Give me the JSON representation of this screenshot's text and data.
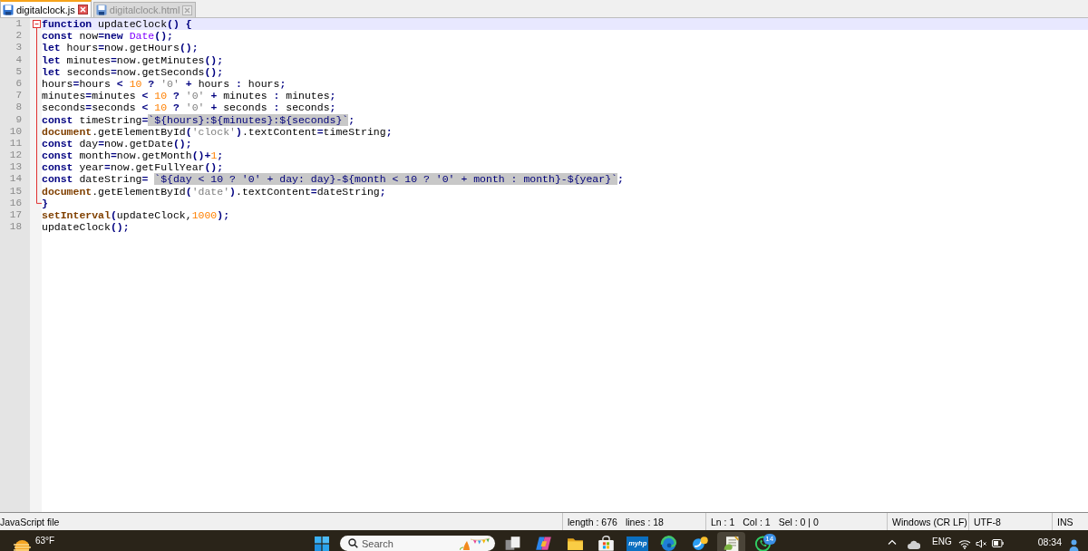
{
  "tabs": [
    {
      "label": "digitalclock.js",
      "selected": true
    },
    {
      "label": "digitalclock.html",
      "selected": false
    }
  ],
  "editor": {
    "lines": [
      {
        "number": "1",
        "current": true,
        "expanded": true,
        "tokens": [
          {
            "kind": "keyword",
            "text": "function"
          },
          {
            "kind": "plain",
            "text": " updateClock"
          },
          {
            "kind": "operator",
            "text": "() {"
          }
        ],
        "children": [
          {
            "number": "2",
            "current": false,
            "tokens": [
              {
                "kind": "keyword",
                "text": "const"
              },
              {
                "kind": "plain",
                "text": " now"
              },
              {
                "kind": "operator",
                "text": "="
              },
              {
                "kind": "keyword",
                "text": "new"
              },
              {
                "kind": "class",
                "text": " Date"
              },
              {
                "kind": "operator",
                "text": "();"
              }
            ]
          },
          {
            "number": "3",
            "current": false,
            "tokens": [
              {
                "kind": "keyword",
                "text": "let"
              },
              {
                "kind": "plain",
                "text": " hours"
              },
              {
                "kind": "operator",
                "text": "="
              },
              {
                "kind": "plain",
                "text": "now.getHours"
              },
              {
                "kind": "operator",
                "text": "();"
              }
            ]
          },
          {
            "number": "4",
            "current": false,
            "tokens": [
              {
                "kind": "keyword",
                "text": "let"
              },
              {
                "kind": "plain",
                "text": " minutes"
              },
              {
                "kind": "operator",
                "text": "="
              },
              {
                "kind": "plain",
                "text": "now.getMinutes"
              },
              {
                "kind": "operator",
                "text": "();"
              }
            ]
          },
          {
            "number": "5",
            "current": false,
            "tokens": [
              {
                "kind": "keyword",
                "text": "let"
              },
              {
                "kind": "plain",
                "text": " seconds"
              },
              {
                "kind": "operator",
                "text": "="
              },
              {
                "kind": "plain",
                "text": "now.getSeconds"
              },
              {
                "kind": "operator",
                "text": "();"
              }
            ]
          },
          {
            "number": "6",
            "current": false,
            "tokens": [
              {
                "kind": "plain",
                "text": "hours"
              },
              {
                "kind": "operator",
                "text": "="
              },
              {
                "kind": "plain",
                "text": "hours "
              },
              {
                "kind": "operator",
                "text": "< "
              },
              {
                "kind": "number",
                "text": "10"
              },
              {
                "kind": "operator",
                "text": " ? "
              },
              {
                "kind": "string",
                "text": "'0'"
              },
              {
                "kind": "operator",
                "text": " + "
              },
              {
                "kind": "plain",
                "text": "hours "
              },
              {
                "kind": "operator",
                "text": ":"
              },
              {
                "kind": "plain",
                "text": " hours"
              },
              {
                "kind": "operator",
                "text": ";"
              }
            ]
          },
          {
            "number": "7",
            "current": false,
            "tokens": [
              {
                "kind": "plain",
                "text": "minutes"
              },
              {
                "kind": "operator",
                "text": "="
              },
              {
                "kind": "plain",
                "text": "minutes "
              },
              {
                "kind": "operator",
                "text": "< "
              },
              {
                "kind": "number",
                "text": "10"
              },
              {
                "kind": "operator",
                "text": " ? "
              },
              {
                "kind": "string",
                "text": "'0'"
              },
              {
                "kind": "operator",
                "text": " + "
              },
              {
                "kind": "plain",
                "text": "minutes "
              },
              {
                "kind": "operator",
                "text": ":"
              },
              {
                "kind": "plain",
                "text": " minutes"
              },
              {
                "kind": "operator",
                "text": ";"
              }
            ]
          },
          {
            "number": "8",
            "current": false,
            "tokens": [
              {
                "kind": "plain",
                "text": "seconds"
              },
              {
                "kind": "operator",
                "text": "="
              },
              {
                "kind": "plain",
                "text": "seconds "
              },
              {
                "kind": "operator",
                "text": "< "
              },
              {
                "kind": "number",
                "text": "10"
              },
              {
                "kind": "operator",
                "text": " ? "
              },
              {
                "kind": "string",
                "text": "'0'"
              },
              {
                "kind": "operator",
                "text": " + "
              },
              {
                "kind": "plain",
                "text": "seconds "
              },
              {
                "kind": "operator",
                "text": ":"
              },
              {
                "kind": "plain",
                "text": " seconds"
              },
              {
                "kind": "operator",
                "text": ";"
              }
            ]
          },
          {
            "number": "9",
            "current": false,
            "tokens": [
              {
                "kind": "keyword",
                "text": "const"
              },
              {
                "kind": "plain",
                "text": " timeString"
              },
              {
                "kind": "operator",
                "text": "="
              },
              {
                "kind": "template",
                "text": "`${hours}:${minutes}:${seconds}`"
              },
              {
                "kind": "operator",
                "text": ";"
              }
            ]
          },
          {
            "number": "10",
            "current": false,
            "tokens": [
              {
                "kind": "object",
                "text": "document"
              },
              {
                "kind": "plain",
                "text": ".getElementById"
              },
              {
                "kind": "operator",
                "text": "("
              },
              {
                "kind": "string",
                "text": "'clock'"
              },
              {
                "kind": "operator",
                "text": ")"
              },
              {
                "kind": "plain",
                "text": ".textContent"
              },
              {
                "kind": "operator",
                "text": "="
              },
              {
                "kind": "plain",
                "text": "timeString"
              },
              {
                "kind": "operator",
                "text": ";"
              }
            ]
          },
          {
            "number": "11",
            "current": false,
            "tokens": [
              {
                "kind": "keyword",
                "text": "const"
              },
              {
                "kind": "plain",
                "text": " day"
              },
              {
                "kind": "operator",
                "text": "="
              },
              {
                "kind": "plain",
                "text": "now.getDate"
              },
              {
                "kind": "operator",
                "text": "();"
              }
            ]
          },
          {
            "number": "12",
            "current": false,
            "tokens": [
              {
                "kind": "keyword",
                "text": "const"
              },
              {
                "kind": "plain",
                "text": " month"
              },
              {
                "kind": "operator",
                "text": "="
              },
              {
                "kind": "plain",
                "text": "now.getMonth"
              },
              {
                "kind": "operator",
                "text": "()+"
              },
              {
                "kind": "number",
                "text": "1"
              },
              {
                "kind": "operator",
                "text": ";"
              }
            ]
          },
          {
            "number": "13",
            "current": false,
            "tokens": [
              {
                "kind": "keyword",
                "text": "const"
              },
              {
                "kind": "plain",
                "text": " year"
              },
              {
                "kind": "operator",
                "text": "="
              },
              {
                "kind": "plain",
                "text": "now.getFullYear"
              },
              {
                "kind": "operator",
                "text": "();"
              }
            ]
          },
          {
            "number": "14",
            "current": false,
            "tokens": [
              {
                "kind": "keyword",
                "text": "const"
              },
              {
                "kind": "plain",
                "text": " dateString"
              },
              {
                "kind": "operator",
                "text": "= "
              },
              {
                "kind": "template",
                "text": "`${day < 10 ? '0' + day: day}-${month < 10 ? '0' + month : month}-${year}`"
              },
              {
                "kind": "operator",
                "text": ";"
              }
            ]
          },
          {
            "number": "15",
            "current": false,
            "tokens": [
              {
                "kind": "object",
                "text": "document"
              },
              {
                "kind": "plain",
                "text": ".getElementById"
              },
              {
                "kind": "operator",
                "text": "("
              },
              {
                "kind": "string",
                "text": "'date'"
              },
              {
                "kind": "operator",
                "text": ")"
              },
              {
                "kind": "plain",
                "text": ".textContent"
              },
              {
                "kind": "operator",
                "text": "="
              },
              {
                "kind": "plain",
                "text": "dateString"
              },
              {
                "kind": "operator",
                "text": ";"
              }
            ]
          },
          {
            "number": "16",
            "current": false,
            "tokens": [
              {
                "kind": "operator",
                "text": "}"
              }
            ]
          }
        ]
      },
      {
        "number": "17",
        "current": false,
        "tokens": [
          {
            "kind": "object",
            "text": "setInterval"
          },
          {
            "kind": "operator",
            "text": "("
          },
          {
            "kind": "plain",
            "text": "updateClock,"
          },
          {
            "kind": "number",
            "text": "1000"
          },
          {
            "kind": "operator",
            "text": ");"
          }
        ]
      },
      {
        "number": "18",
        "current": false,
        "tokens": [
          {
            "kind": "plain",
            "text": "updateClock"
          },
          {
            "kind": "operator",
            "text": "();"
          }
        ]
      }
    ]
  },
  "status_bar": {
    "file_type": "JavaScript file",
    "length": "length : 676",
    "lines": "lines : 18",
    "line": "Ln : 1",
    "column": "Col : 1",
    "selection": "Sel : 0 | 0",
    "line_endings": "Windows (CR LF)",
    "encoding": "UTF-8",
    "insert_mode": "INS"
  },
  "taskbar": {
    "weather": {
      "temperature": "63°F"
    },
    "search": {
      "placeholder": "Search"
    },
    "apps": [
      {
        "kind": "task-view",
        "selected": false
      },
      {
        "kind": "copilot",
        "selected": false
      },
      {
        "kind": "files",
        "selected": false
      },
      {
        "kind": "store",
        "selected": false
      },
      {
        "kind": "myhp",
        "label": "myhp",
        "selected": false
      },
      {
        "kind": "edge",
        "selected": false
      },
      {
        "kind": "browser",
        "selected": false
      },
      {
        "kind": "notepad",
        "selected": true
      },
      {
        "kind": "whatsapp",
        "badge": "14",
        "selected": false
      }
    ],
    "tray": {
      "language": "ENG",
      "time": "08:34"
    }
  }
}
